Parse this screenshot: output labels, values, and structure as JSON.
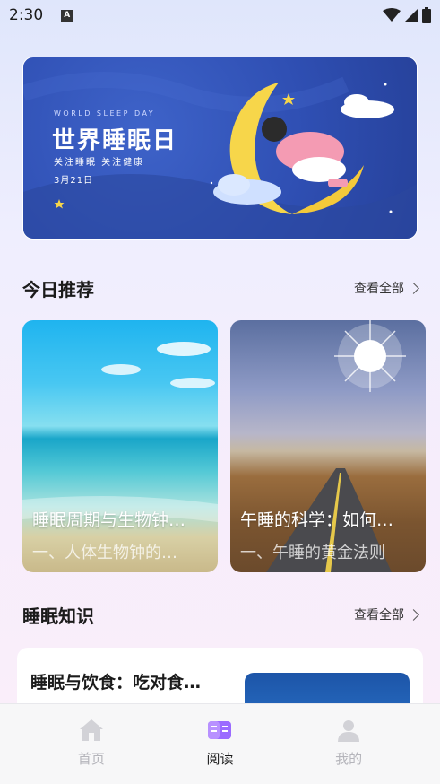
{
  "status_bar": {
    "time": "2:30",
    "a_badge": "A"
  },
  "banner": {
    "en": "WORLD SLEEP DAY",
    "title": "世界睡眠日",
    "subtitle": "关注睡眠  关注健康",
    "date": "3月21日"
  },
  "recommend": {
    "title": "今日推荐",
    "link": "查看全部",
    "cards": [
      {
        "title": "睡眠周期与生物钟…",
        "subtitle": "一、人体生物钟的…"
      },
      {
        "title": "午睡的科学：如何…",
        "subtitle": "一、午睡的黄金法则"
      }
    ]
  },
  "knowledge": {
    "title": "睡眠知识",
    "link": "查看全部",
    "items": [
      {
        "title": "睡眠与饮食：吃对食…"
      }
    ]
  },
  "tabbar": {
    "tabs": [
      {
        "label": "首页",
        "icon": "home-icon",
        "active": false
      },
      {
        "label": "阅读",
        "icon": "book-icon",
        "active": true
      },
      {
        "label": "我的",
        "icon": "profile-icon",
        "active": false
      }
    ]
  },
  "colors": {
    "accent": "#8b5cf6",
    "inactive": "#c9c9ce",
    "banner_blue": "#2f4fb3"
  }
}
